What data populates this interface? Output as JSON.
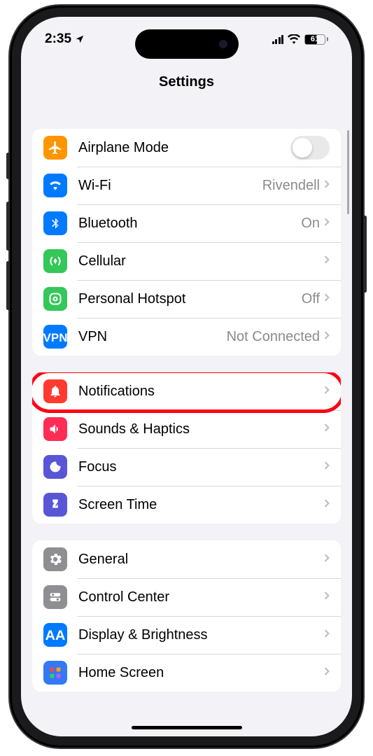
{
  "status": {
    "time": "2:35",
    "battery": "61"
  },
  "navbar": {
    "title": "Settings"
  },
  "groups": [
    {
      "rows": [
        {
          "icon": "airplane",
          "color": "bg-orange",
          "label": "Airplane Mode",
          "control": "toggle"
        },
        {
          "icon": "wifi",
          "color": "bg-blue",
          "label": "Wi-Fi",
          "value": "Rivendell",
          "control": "link"
        },
        {
          "icon": "bluetooth",
          "color": "bg-blue",
          "label": "Bluetooth",
          "value": "On",
          "control": "link"
        },
        {
          "icon": "cellular",
          "color": "bg-green",
          "label": "Cellular",
          "control": "link"
        },
        {
          "icon": "hotspot",
          "color": "bg-green",
          "label": "Personal Hotspot",
          "value": "Off",
          "control": "link"
        },
        {
          "icon": "vpn",
          "color": "bg-vpn",
          "label": "VPN",
          "value": "Not Connected",
          "control": "link"
        }
      ]
    },
    {
      "rows": [
        {
          "icon": "notifications",
          "color": "bg-red",
          "label": "Notifications",
          "control": "link",
          "highlight": true
        },
        {
          "icon": "sounds",
          "color": "bg-pink",
          "label": "Sounds & Haptics",
          "control": "link"
        },
        {
          "icon": "focus",
          "color": "bg-indigo",
          "label": "Focus",
          "control": "link"
        },
        {
          "icon": "screentime",
          "color": "bg-indigo",
          "label": "Screen Time",
          "control": "link"
        }
      ]
    },
    {
      "rows": [
        {
          "icon": "general",
          "color": "bg-gray",
          "label": "General",
          "control": "link"
        },
        {
          "icon": "controlcenter",
          "color": "bg-gray",
          "label": "Control Center",
          "control": "link"
        },
        {
          "icon": "display",
          "color": "bg-blue2",
          "label": "Display & Brightness",
          "control": "link"
        },
        {
          "icon": "homescreen",
          "color": "bg-hs",
          "label": "Home Screen",
          "control": "link"
        }
      ]
    }
  ]
}
